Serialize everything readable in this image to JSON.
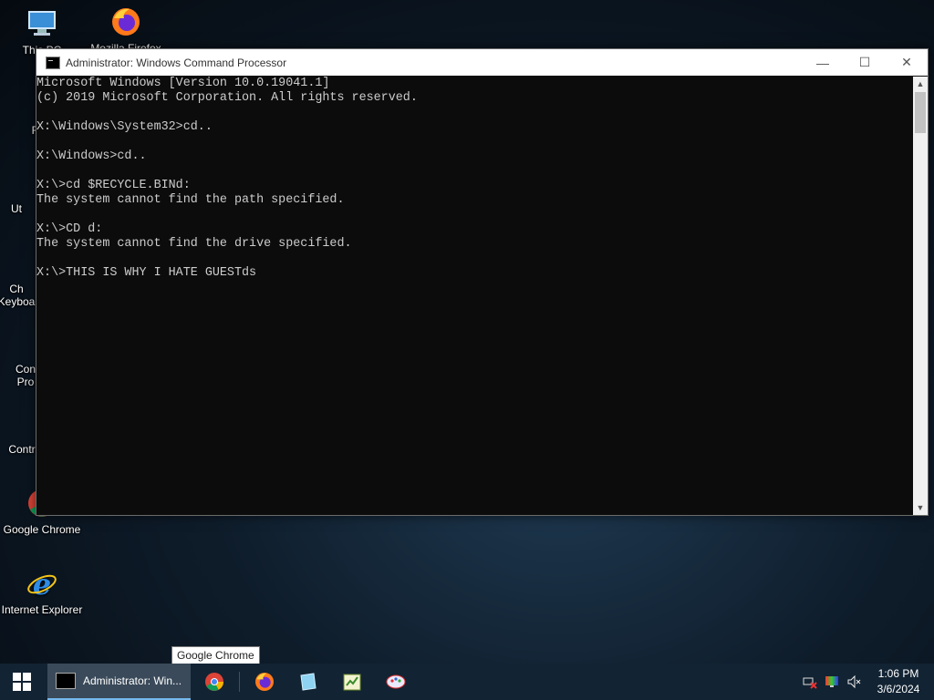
{
  "desktop": {
    "icons": [
      {
        "label": "This PC"
      },
      {
        "label": "Mozilla Firefox"
      },
      {
        "label": "Recy"
      },
      {
        "label": "Ut"
      },
      {
        "label": "Ch"
      },
      {
        "label": "Keyboa"
      },
      {
        "label": "Con"
      },
      {
        "label": "Pro"
      },
      {
        "label": "Contr"
      },
      {
        "label": "Google Chrome"
      },
      {
        "label": "Internet Explorer"
      }
    ]
  },
  "window": {
    "title": "Administrator: Windows Command Processor",
    "controls": {
      "minimize": "—",
      "maximize": "☐",
      "close": "✕"
    }
  },
  "console": {
    "lines": [
      "Microsoft Windows [Version 10.0.19041.1]",
      "(c) 2019 Microsoft Corporation. All rights reserved.",
      "",
      "X:\\Windows\\System32>cd..",
      "",
      "X:\\Windows>cd..",
      "",
      "X:\\>cd $RECYCLE.BINd:",
      "The system cannot find the path specified.",
      "",
      "X:\\>CD d:",
      "The system cannot find the drive specified.",
      "",
      "X:\\>THIS IS WHY I HATE GUESTds"
    ]
  },
  "tooltip": {
    "text": "Google Chrome"
  },
  "taskbar": {
    "active_task_label": "Administrator: Win...",
    "pinned": [
      "chrome-icon",
      "firefox-icon",
      "explorer-icon",
      "notepad-icon",
      "paint-icon"
    ],
    "clock": {
      "time": "1:06 PM",
      "date": "3/6/2024"
    }
  }
}
